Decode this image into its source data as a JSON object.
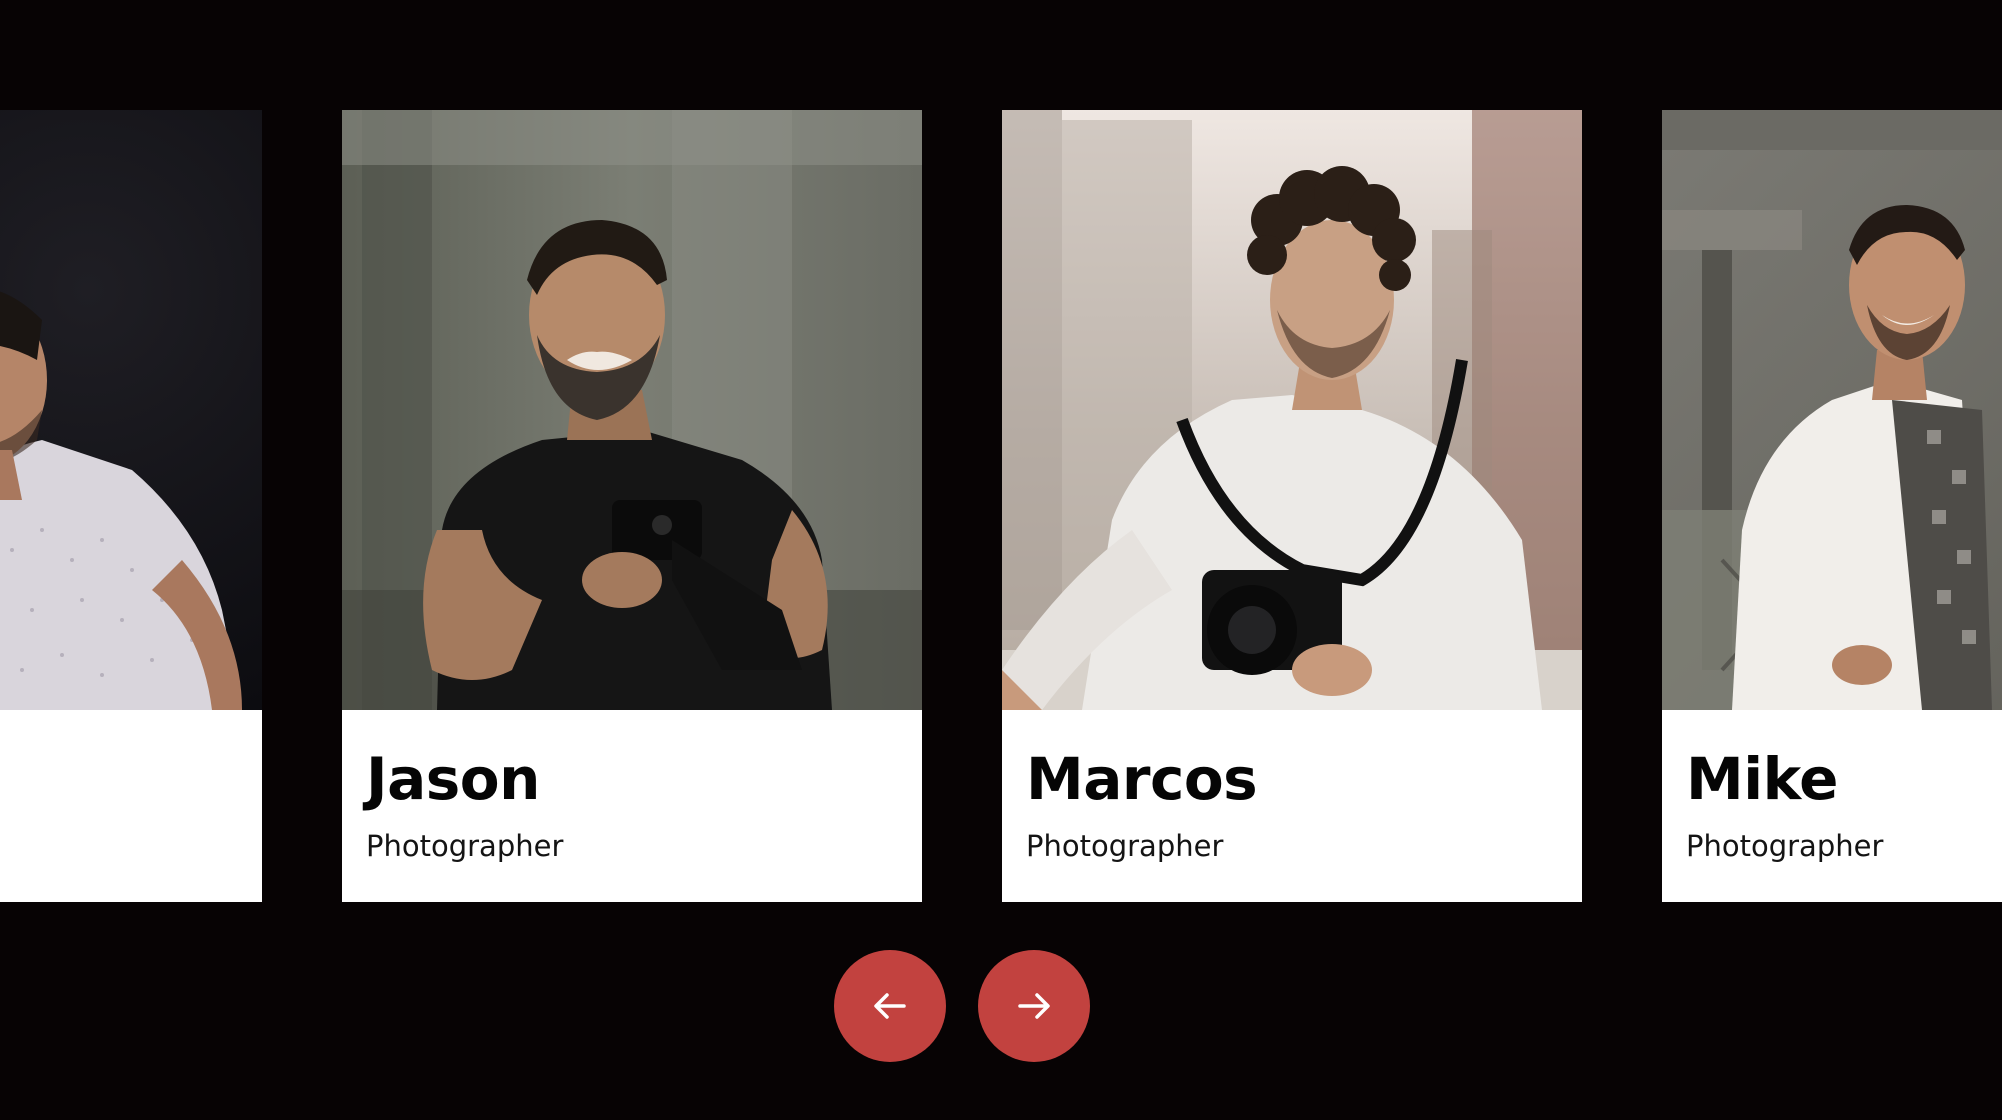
{
  "carousel": {
    "cards": [
      {
        "name": "",
        "role": ""
      },
      {
        "name": "Jason",
        "role": "Photographer"
      },
      {
        "name": "Marcos",
        "role": "Photographer"
      },
      {
        "name": "Mike",
        "role": "Photographer"
      }
    ],
    "prev_icon": "arrow-left-icon",
    "next_icon": "arrow-right-icon"
  },
  "colors": {
    "background": "#070304",
    "card_background": "#ffffff",
    "accent": "#c2423f",
    "name_text": "#050505",
    "role_text": "#141414"
  }
}
